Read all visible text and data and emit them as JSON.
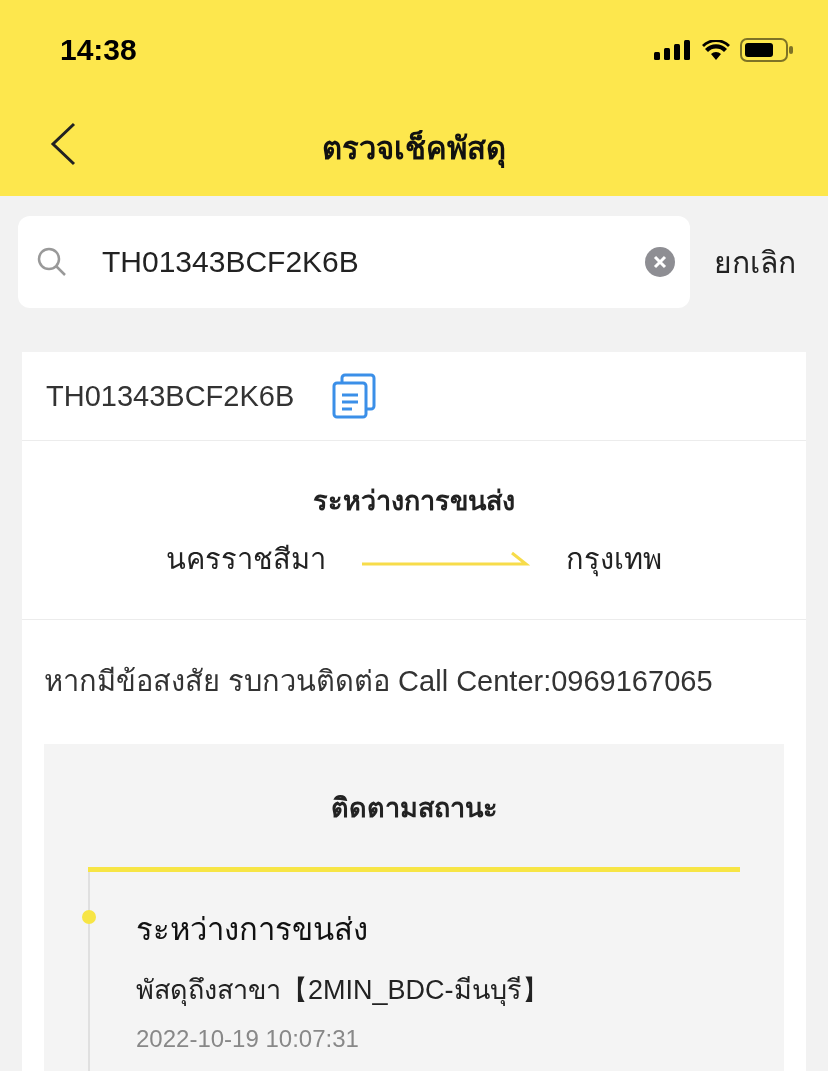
{
  "status_bar": {
    "time": "14:38"
  },
  "header": {
    "title": "ตรวจเช็คพัสดุ"
  },
  "search": {
    "value": "TH01343BCF2K6B",
    "cancel": "ยกเลิก"
  },
  "parcel": {
    "tracking_number": "TH01343BCF2K6B",
    "status": "ระหว่างการขนส่ง",
    "origin": "นครราชสีมา",
    "destination": "กรุงเทพ"
  },
  "contact": "หากมีข้อสงสัย รบกวนติดต่อ Call Center:0969167065",
  "tracking": {
    "title": "ติดตามสถานะ",
    "events": [
      {
        "status": "ระหว่างการขนส่ง",
        "detail": "พัสดุถึงสาขา【2MIN_BDC-มีนบุรี】",
        "time": "2022-10-19 10:07:31",
        "selected": true
      }
    ]
  }
}
